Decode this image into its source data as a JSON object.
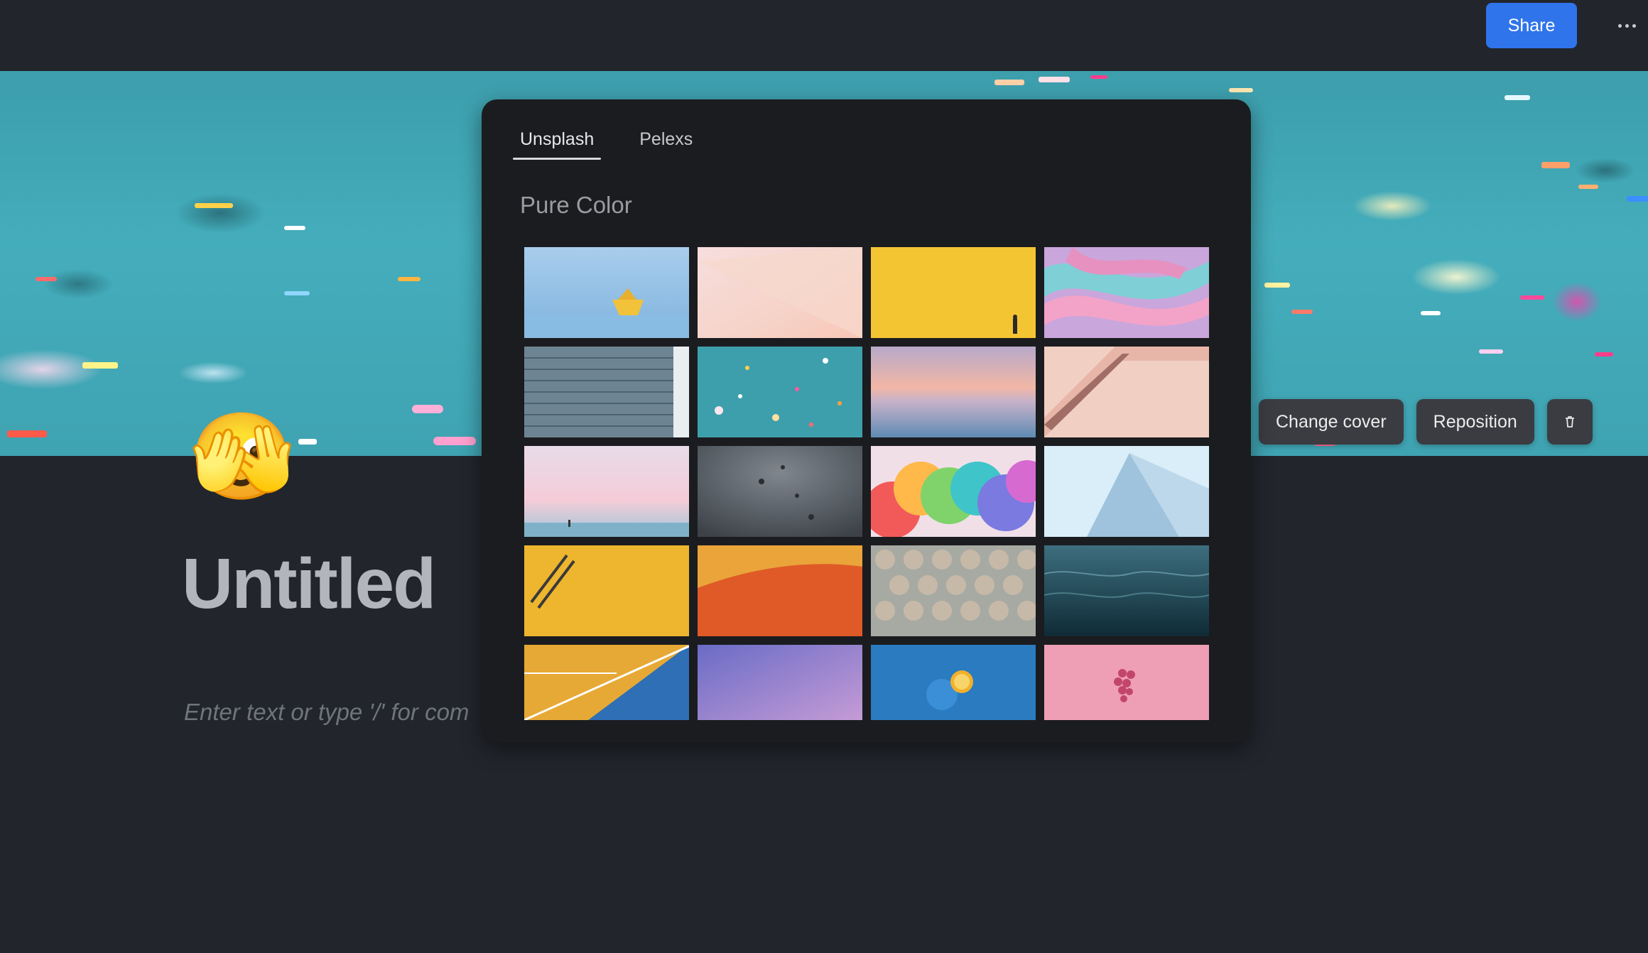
{
  "topbar": {
    "share_label": "Share",
    "more_icon": "more-horizontal-icon"
  },
  "page": {
    "emoji": "🫣",
    "title": "Untitled",
    "placeholder": "Enter text or type '/' for com"
  },
  "cover_actions": {
    "change_cover_label": "Change cover",
    "reposition_label": "Reposition",
    "delete_icon": "trash-icon"
  },
  "picker": {
    "tabs": [
      {
        "label": "Unsplash",
        "active": true
      },
      {
        "label": "Pelexs",
        "active": false
      }
    ],
    "section_title": "Pure Color",
    "images": [
      {
        "name": "paper-boat"
      },
      {
        "name": "pink-gradient"
      },
      {
        "name": "yellow-wall"
      },
      {
        "name": "pink-marble"
      },
      {
        "name": "blue-brick"
      },
      {
        "name": "teal-confetti"
      },
      {
        "name": "sunset-sea"
      },
      {
        "name": "pink-stairs"
      },
      {
        "name": "misty-beach"
      },
      {
        "name": "rain-glass"
      },
      {
        "name": "rainbow-smoke"
      },
      {
        "name": "blue-skyscraper"
      },
      {
        "name": "yellow-pencils"
      },
      {
        "name": "orange-court"
      },
      {
        "name": "pastel-tiles"
      },
      {
        "name": "dark-water"
      },
      {
        "name": "court-lines"
      },
      {
        "name": "purple-gradient"
      },
      {
        "name": "blue-lemon"
      },
      {
        "name": "pink-grapes"
      }
    ]
  }
}
